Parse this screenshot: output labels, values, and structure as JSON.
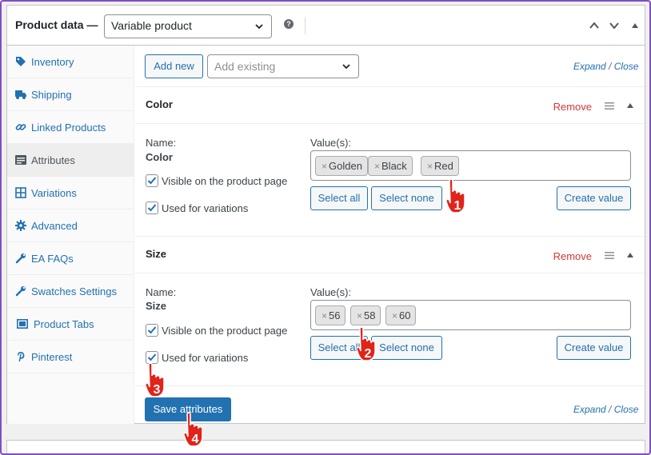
{
  "header": {
    "title": "Product data —",
    "product_type": "Variable product",
    "help_glyph": "?"
  },
  "sidebar": {
    "items": [
      {
        "label": "Inventory",
        "icon": "tag-icon"
      },
      {
        "label": "Shipping",
        "icon": "truck-icon"
      },
      {
        "label": "Linked Products",
        "icon": "link-icon"
      },
      {
        "label": "Attributes",
        "icon": "list-icon",
        "active": true
      },
      {
        "label": "Variations",
        "icon": "grid-icon"
      },
      {
        "label": "Advanced",
        "icon": "gear-icon"
      },
      {
        "label": "EA FAQs",
        "icon": "wrench-icon"
      },
      {
        "label": "Swatches Settings",
        "icon": "wrench-icon"
      },
      {
        "label": "Product Tabs",
        "icon": "tabs-icon"
      },
      {
        "label": "Pinterest",
        "icon": "pinterest-icon"
      }
    ]
  },
  "toolbar": {
    "add_new": "Add new",
    "add_existing_placeholder": "Add existing",
    "expand": "Expand",
    "slash": "/",
    "close": "Close"
  },
  "attributes": [
    {
      "name": "Color",
      "remove": "Remove",
      "name_label": "Name:",
      "values_label": "Value(s):",
      "values": [
        "Golden",
        "Black",
        "Red"
      ],
      "visible_label": "Visible on the product page",
      "visible_checked": true,
      "variations_label": "Used for variations",
      "variations_checked": true,
      "select_all": "Select all",
      "select_none": "Select none",
      "create_value": "Create value"
    },
    {
      "name": "Size",
      "remove": "Remove",
      "name_label": "Name:",
      "values_label": "Value(s):",
      "values": [
        "56",
        "58",
        "60"
      ],
      "visible_label": "Visible on the product page",
      "visible_checked": true,
      "variations_label": "Used for variations",
      "variations_checked": true,
      "select_all": "Select all",
      "select_none": "Select none",
      "create_value": "Create value"
    }
  ],
  "footer": {
    "save": "Save attributes",
    "expand": "Expand",
    "slash": "/",
    "close": "Close"
  },
  "annotations": [
    "1",
    "2",
    "3",
    "4"
  ],
  "colors": {
    "accent": "#2271b1",
    "remove": "#d63638",
    "pointer": "#e2231a",
    "frame": "#7e4fc1"
  }
}
